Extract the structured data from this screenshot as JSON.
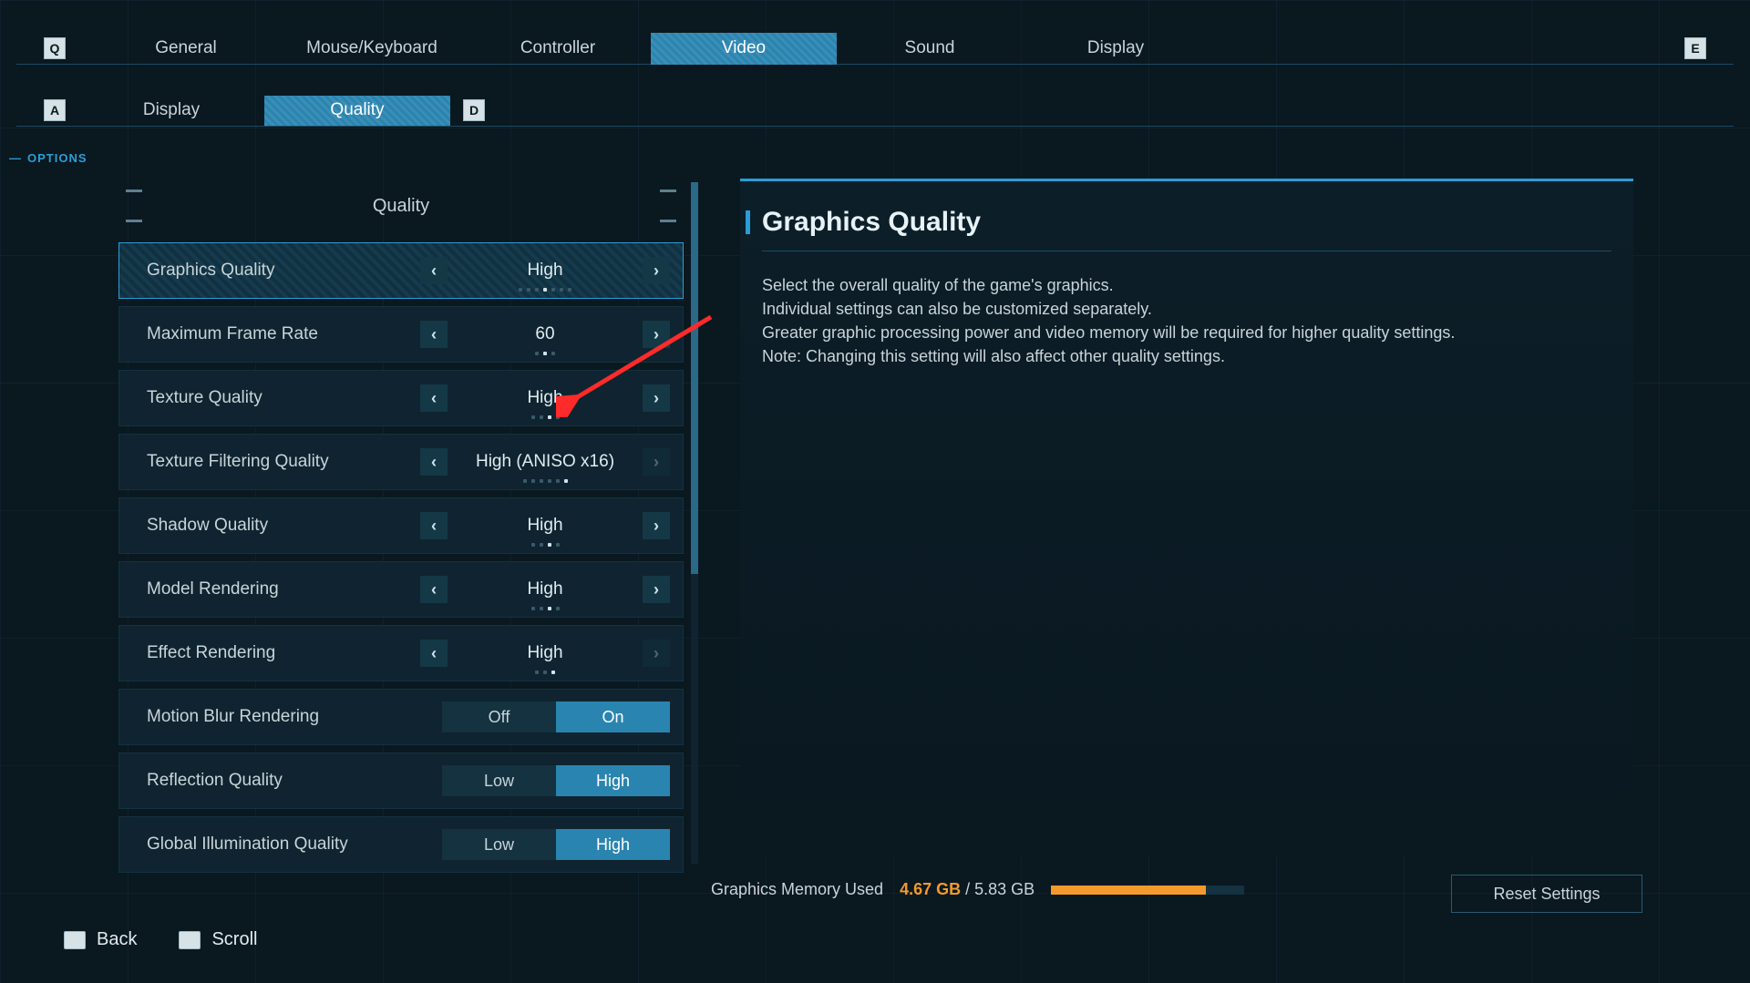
{
  "page_label": "OPTIONS",
  "top_key_prev": "Q",
  "top_key_next": "E",
  "top_tabs": [
    "General",
    "Mouse/Keyboard",
    "Controller",
    "Video",
    "Sound",
    "Display"
  ],
  "top_active": "Video",
  "sub_key_prev": "A",
  "sub_key_next": "D",
  "sub_tabs": [
    "Display",
    "Quality"
  ],
  "sub_active": "Quality",
  "section_title": "Quality",
  "rows": [
    {
      "label": "Graphics Quality",
      "value": "High",
      "dots": 7,
      "dot_on": 3,
      "selected": true,
      "left_dim": false,
      "right_dim": false,
      "type": "cycle"
    },
    {
      "label": "Maximum Frame Rate",
      "value": "60",
      "dots": 3,
      "dot_on": 1,
      "selected": false,
      "left_dim": false,
      "right_dim": false,
      "type": "cycle"
    },
    {
      "label": "Texture Quality",
      "value": "High",
      "dots": 4,
      "dot_on": 2,
      "selected": false,
      "left_dim": false,
      "right_dim": false,
      "type": "cycle"
    },
    {
      "label": "Texture Filtering Quality",
      "value": "High (ANISO x16)",
      "dots": 6,
      "dot_on": 5,
      "selected": false,
      "left_dim": false,
      "right_dim": true,
      "type": "cycle"
    },
    {
      "label": "Shadow Quality",
      "value": "High",
      "dots": 4,
      "dot_on": 2,
      "selected": false,
      "left_dim": false,
      "right_dim": false,
      "type": "cycle"
    },
    {
      "label": "Model Rendering",
      "value": "High",
      "dots": 4,
      "dot_on": 2,
      "selected": false,
      "left_dim": false,
      "right_dim": false,
      "type": "cycle"
    },
    {
      "label": "Effect Rendering",
      "value": "High",
      "dots": 3,
      "dot_on": 2,
      "selected": false,
      "left_dim": false,
      "right_dim": true,
      "type": "cycle"
    },
    {
      "label": "Motion Blur Rendering",
      "options": [
        "Off",
        "On"
      ],
      "active": "On",
      "type": "toggle"
    },
    {
      "label": "Reflection Quality",
      "options": [
        "Low",
        "High"
      ],
      "active": "High",
      "type": "toggle"
    },
    {
      "label": "Global Illumination Quality",
      "options": [
        "Low",
        "High"
      ],
      "active": "High",
      "type": "toggle"
    }
  ],
  "desc_title": "Graphics Quality",
  "desc_body": "Select the overall quality of the game's graphics.\nIndividual settings can also be customized separately.\nGreater graphic processing power and video memory will be required for higher quality settings.\nNote: Changing this setting will also affect other quality settings.",
  "memory_label": "Graphics Memory Used",
  "memory_used": "4.67 GB",
  "memory_total": "5.83 GB",
  "memory_fill_pct": 80,
  "reset_label": "Reset Settings",
  "hint_back": "Back",
  "hint_scroll": "Scroll"
}
